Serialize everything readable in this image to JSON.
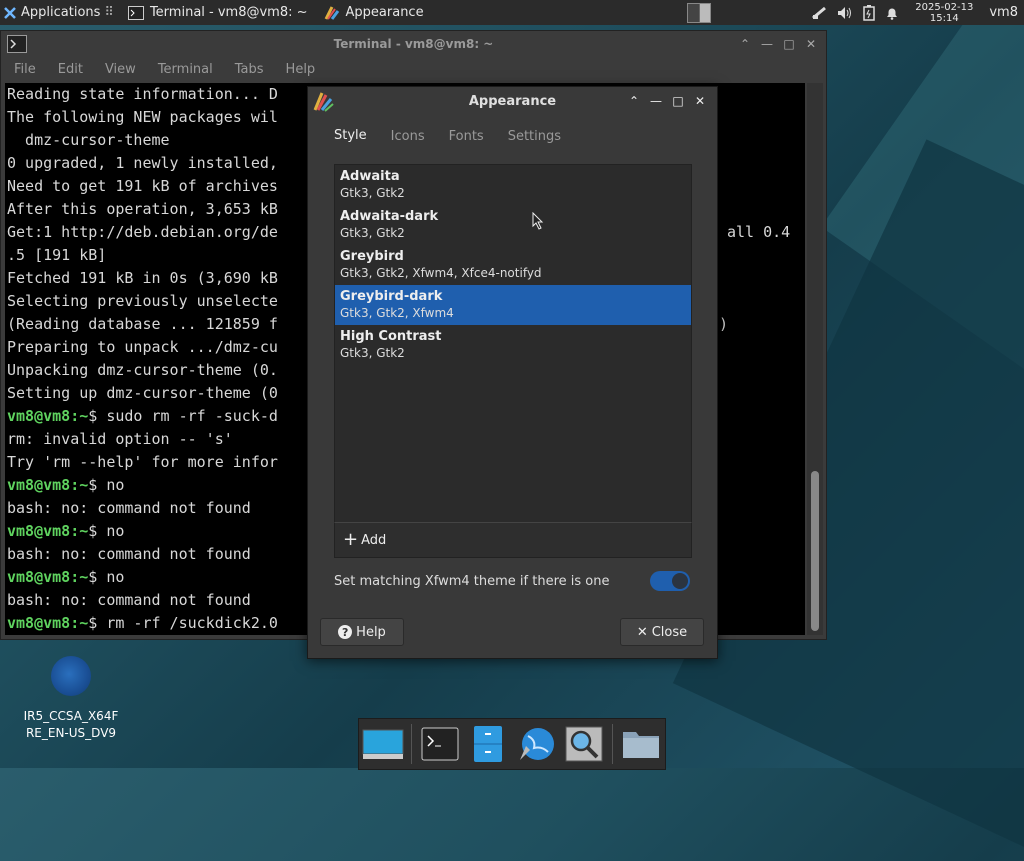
{
  "panel": {
    "app_menu_label": "Applications",
    "tasks": [
      {
        "label": "Terminal - vm8@vm8: ~"
      },
      {
        "label": "Appearance"
      }
    ],
    "clock_date": "2025-02-13",
    "clock_time": "15:14",
    "user": "vm8"
  },
  "terminal": {
    "title": "Terminal - vm8@vm8: ~",
    "menu": [
      "File",
      "Edit",
      "View",
      "Terminal",
      "Tabs",
      "Help"
    ],
    "lines": [
      "Reading state information... D",
      "The following NEW packages wil",
      "  dmz-cursor-theme",
      "0 upgraded, 1 newly installed,",
      "Need to get 191 kB of archives",
      "After this operation, 3,653 kB",
      "Get:1 http://deb.debian.org/de",
      ".5 [191 kB]",
      "Fetched 191 kB in 0s (3,690 kB",
      "Selecting previously unselecte",
      "(Reading database ... 121859 f",
      "Preparing to unpack .../dmz-cu",
      "Unpacking dmz-cursor-theme (0.",
      "Setting up dmz-cursor-theme (0"
    ],
    "right_fragments": {
      "line7": "all 0.4",
      "line11": ")"
    },
    "prompt": "vm8@vm8:~$",
    "session": [
      {
        "prompt": true,
        "text": " sudo rm -rf -suck-d"
      },
      {
        "prompt": false,
        "text": "rm: invalid option -- 's'"
      },
      {
        "prompt": false,
        "text": "Try 'rm --help' for more infor"
      },
      {
        "prompt": true,
        "text": " no"
      },
      {
        "prompt": false,
        "text": "bash: no: command not found"
      },
      {
        "prompt": true,
        "text": " no"
      },
      {
        "prompt": false,
        "text": "bash: no: command not found"
      },
      {
        "prompt": true,
        "text": " no"
      },
      {
        "prompt": false,
        "text": "bash: no: command not found"
      },
      {
        "prompt": true,
        "text": " rm -rf /suckdick2.0"
      }
    ]
  },
  "appearance": {
    "title": "Appearance",
    "tabs": [
      "Style",
      "Icons",
      "Fonts",
      "Settings"
    ],
    "active_tab": "Style",
    "themes": [
      {
        "name": "Adwaita",
        "sub": "Gtk3, Gtk2"
      },
      {
        "name": "Adwaita-dark",
        "sub": "Gtk3, Gtk2"
      },
      {
        "name": "Greybird",
        "sub": "Gtk3, Gtk2, Xfwm4, Xfce4-notifyd"
      },
      {
        "name": "Greybird-dark",
        "sub": "Gtk3, Gtk2, Xfwm4"
      },
      {
        "name": "High Contrast",
        "sub": "Gtk3, Gtk2"
      }
    ],
    "selected_theme": "Greybird-dark",
    "add_label": "Add",
    "match_label": "Set matching Xfwm4 theme if there is one",
    "match_enabled": true,
    "help_label": "Help",
    "close_label": "Close"
  },
  "desktop": {
    "icon_label": "IR5_CCSA_X64FRE_EN-US_DV9"
  },
  "colors": {
    "accent": "#1f5fae",
    "prompt": "#5fd35f"
  }
}
